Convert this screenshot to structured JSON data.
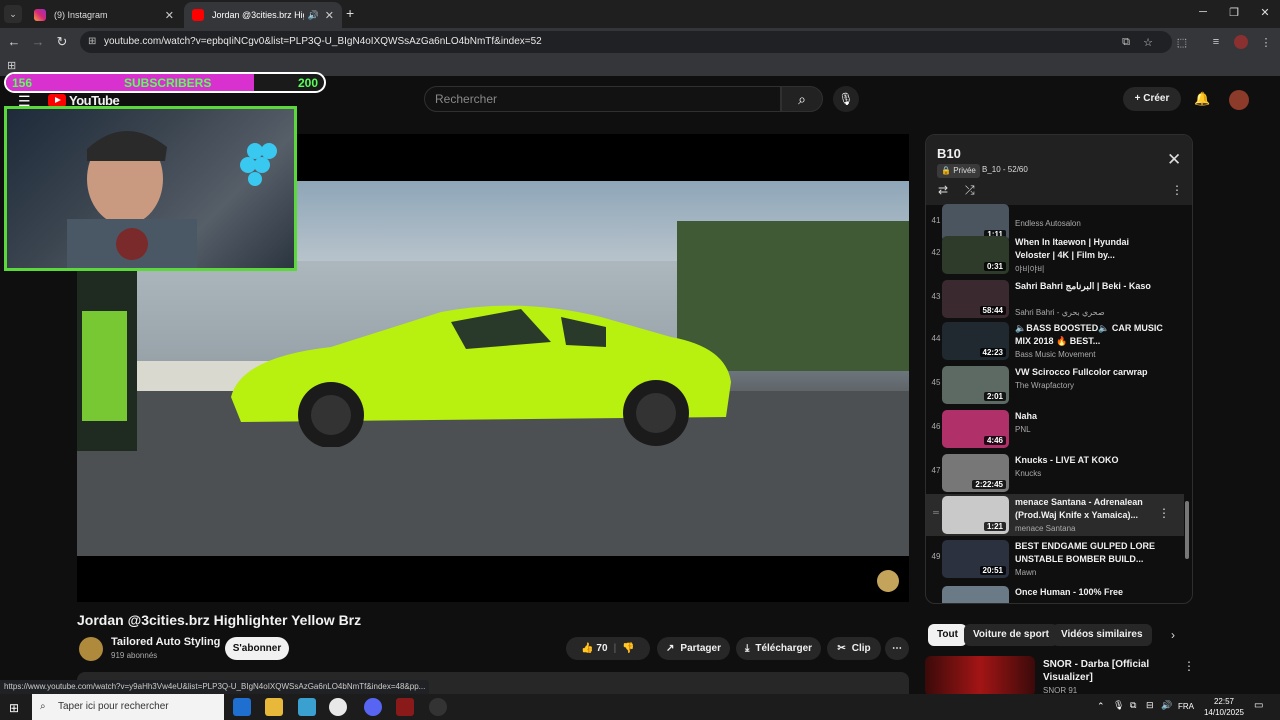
{
  "tabs": [
    {
      "title": "(9) Instagram",
      "close": "✕"
    },
    {
      "title": "Jordan @3cities.brz Highlig",
      "close": "✕",
      "audio": "🔊"
    }
  ],
  "url": "youtube.com/watch?v=epbqIiNCgv0&list=PLP3Q-U_BIgN4oIXQWSsAzGa6nLO4bNmTf&index=52",
  "subscribers": {
    "current": "156",
    "label": "SUBSCRIBERS",
    "goal": "200",
    "progress": 0.78
  },
  "yt": {
    "logo": "YouTube",
    "search_placeholder": "Rechercher",
    "create": "Créer"
  },
  "video": {
    "title": "Jordan @3cities.brz Highlighter Yellow Brz",
    "channel": "Tailored Auto Styling",
    "subscribers": "919 abonnés",
    "subscribe": "S'abonner",
    "likes": "70",
    "share": "Partager",
    "download": "Télécharger",
    "clip": "Clip"
  },
  "playlist": {
    "title": "B10",
    "privacy": "Privée",
    "subtitle": "B_10 - 52/60",
    "items": [
      {
        "idx": "41",
        "title": "",
        "channel": "Endless Autosalon",
        "duration": "1:11",
        "color": "#4a5560"
      },
      {
        "idx": "42",
        "title": "When In Itaewon | Hyundai Veloster | 4K | Film by...",
        "channel": "야비야비",
        "duration": "0:31",
        "color": "#2e3a2a"
      },
      {
        "idx": "43",
        "title": "Sahri Bahri البرنامج | Beki - Kaso",
        "channel": "Sahri Bahri - صحري بحري",
        "duration": "58:44",
        "color": "#3a2a30"
      },
      {
        "idx": "44",
        "title": "🔈BASS BOOSTED🔈 CAR MUSIC MIX 2018 🔥 BEST...",
        "channel": "Bass Music Movement",
        "duration": "42:23",
        "color": "#202830"
      },
      {
        "idx": "45",
        "title": "VW Scirocco Fullcolor carwrap",
        "channel": "The Wrapfactory",
        "duration": "2:01",
        "color": "#5d6a64"
      },
      {
        "idx": "46",
        "title": "Naha",
        "channel": "PNL",
        "duration": "4:46",
        "color": "#b0306a"
      },
      {
        "idx": "47",
        "title": "Knucks - LIVE AT KOKO",
        "channel": "Knucks",
        "duration": "2:22:45",
        "color": "#777777"
      },
      {
        "idx": "",
        "title": "menace Santana - Adrenalean (Prod.Waj Knife x Yamaica)...",
        "channel": "menace Santana",
        "duration": "1:21",
        "color": "#c9c9c9",
        "selected": true
      },
      {
        "idx": "49",
        "title": "BEST ENDGAME GULPED LORE UNSTABLE BOMBER BUILD...",
        "channel": "Mawn",
        "duration": "20:51",
        "color": "#2c3140"
      },
      {
        "idx": "",
        "title": "Once Human - 100% Free",
        "channel": "",
        "duration": "",
        "color": "#6a7a86"
      }
    ]
  },
  "chips": [
    "Tout",
    "Voiture de sport",
    "Vidéos similaires"
  ],
  "recommended": {
    "title": "SNOR - Darba [Official Visualizer]",
    "channel": "SNOR 91"
  },
  "status_url": "https://www.youtube.com/watch?v=y9aHh3Vw4eU&list=PLP3Q-U_BIgN4oIXQWSsAzGa6nLO4bNmTf&index=48&pp...",
  "taskbar": {
    "search": "Taper ici pour rechercher",
    "lang": "FRA",
    "time": "22:57",
    "date": "14/10/2025"
  }
}
